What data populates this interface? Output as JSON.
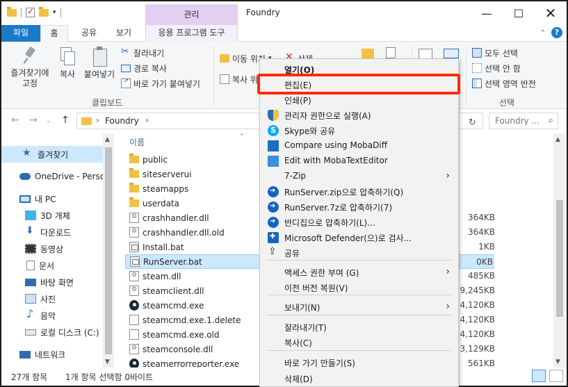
{
  "window": {
    "title": "Foundry",
    "context_tab_group": "관리",
    "buttons": {
      "minimize": "—",
      "maximize": "☐",
      "close": "✕"
    }
  },
  "ribbon_tabs": [
    "파일",
    "홈",
    "공유",
    "보기",
    "응용 프로그램 도구"
  ],
  "ribbon": {
    "clipboard": {
      "pin_label": "즐겨찾기에\n고정",
      "copy_label": "복사",
      "paste_label": "붙여넣기",
      "cut_label": "잘라내기",
      "copy_path_label": "경로 복사",
      "paste_shortcut_label": "바로 가기 붙여넣기",
      "group_label": "클립보드"
    },
    "organize": {
      "move_to_label": "이동 위치",
      "delete_label": "삭제",
      "copy_to_label": "복사 위"
    },
    "select": {
      "select_all": "모두 선택",
      "select_none": "선택 안 함",
      "invert_selection": "선택 영역 반전",
      "group_label": "선택"
    }
  },
  "address": {
    "path": "Foundry",
    "search_placeholder": "Foundry ..."
  },
  "nav": {
    "items": [
      {
        "label": "즐겨찾기",
        "icon": "star-icon"
      },
      {
        "label": "OneDrive - Persor",
        "icon": "cloud-icon"
      },
      {
        "label": "내 PC",
        "icon": "pc-icon"
      },
      {
        "label": "3D 개체",
        "icon": "cube-icon"
      },
      {
        "label": "다운로드",
        "icon": "download-icon"
      },
      {
        "label": "동영상",
        "icon": "video-icon"
      },
      {
        "label": "문서",
        "icon": "document-icon"
      },
      {
        "label": "바탕 화면",
        "icon": "desktop-icon"
      },
      {
        "label": "사진",
        "icon": "picture-icon"
      },
      {
        "label": "음악",
        "icon": "music-icon"
      },
      {
        "label": "로컬 디스크 (C:)",
        "icon": "disk-icon"
      },
      {
        "label": "네트워크",
        "icon": "network-icon"
      }
    ]
  },
  "files": {
    "column_name": "이름",
    "items": [
      {
        "name": "public",
        "type": "folder",
        "size": ""
      },
      {
        "name": "siteserverui",
        "type": "folder",
        "size": ""
      },
      {
        "name": "steamapps",
        "type": "folder",
        "size": ""
      },
      {
        "name": "userdata",
        "type": "folder",
        "size": ""
      },
      {
        "name": "crashhandler.dll",
        "type": "dll",
        "size": "364KB"
      },
      {
        "name": "crashhandler.dll.old",
        "type": "dll",
        "size": "364KB"
      },
      {
        "name": "Install.bat",
        "type": "bat",
        "size": "1KB"
      },
      {
        "name": "RunServer.bat",
        "type": "bat",
        "size": "0KB"
      },
      {
        "name": "steam.dll",
        "type": "dll",
        "size": "485KB"
      },
      {
        "name": "steamclient.dll",
        "type": "dll",
        "size": "9,245KB"
      },
      {
        "name": "steamcmd.exe",
        "type": "steam",
        "size": "4,120KB"
      },
      {
        "name": "steamcmd.exe.1.delete",
        "type": "blank",
        "size": "4,120KB"
      },
      {
        "name": "steamcmd.exe.old",
        "type": "blank",
        "size": "4,120KB"
      },
      {
        "name": "steamconsole.dll",
        "type": "dll",
        "size": "3,129KB"
      },
      {
        "name": "steamerrorreporter.exe",
        "type": "steam",
        "size": "561KB"
      }
    ]
  },
  "status": {
    "count": "27개 항목",
    "selection": "1개 항목 선택함 0바이트"
  },
  "context_menu": {
    "items": [
      {
        "label": "열기(O)",
        "bold": true,
        "icon": ""
      },
      {
        "label": "편집(E)",
        "icon": "",
        "highlighted": true
      },
      {
        "label": "인쇄(P)",
        "icon": ""
      },
      {
        "label": "관리자 권한으로 실행(A)",
        "icon": "shield"
      },
      {
        "label": "Skype와 공유",
        "icon": "skype"
      },
      {
        "label": "Compare using MobaDiff",
        "icon": "moba"
      },
      {
        "label": "Edit with MobaTextEditor",
        "icon": "mobaedit"
      },
      {
        "label": "7-Zip",
        "icon": "",
        "submenu": true
      },
      {
        "label": "RunServer.zip으로 압축하기(Q)",
        "icon": "bandi"
      },
      {
        "label": "RunServer.7z로 압축하기(7)",
        "icon": "bandi"
      },
      {
        "label": "반디집으로 압축하기(L)...",
        "icon": "bandi"
      },
      {
        "label": "Microsoft Defender(으)로 검사...",
        "icon": "defender"
      },
      {
        "label": "공유",
        "icon": "share"
      },
      {
        "label": "액세스 권한 부여 (G)",
        "icon": "",
        "submenu": true
      },
      {
        "label": "이전 버전 복원(V)",
        "icon": ""
      },
      {
        "label": "보내기(N)",
        "icon": "",
        "submenu": true
      },
      {
        "label": "잘라내기(T)",
        "icon": ""
      },
      {
        "label": "복사(C)",
        "icon": ""
      },
      {
        "label": "바로 가기 만들기(S)",
        "icon": ""
      },
      {
        "label": "삭제(D)",
        "icon": ""
      }
    ]
  },
  "colors": {
    "accent": "#1979ca",
    "selection": "#cce8ff",
    "highlight_box": "#ff2a0d",
    "context_tab": "#e1d0f0"
  }
}
